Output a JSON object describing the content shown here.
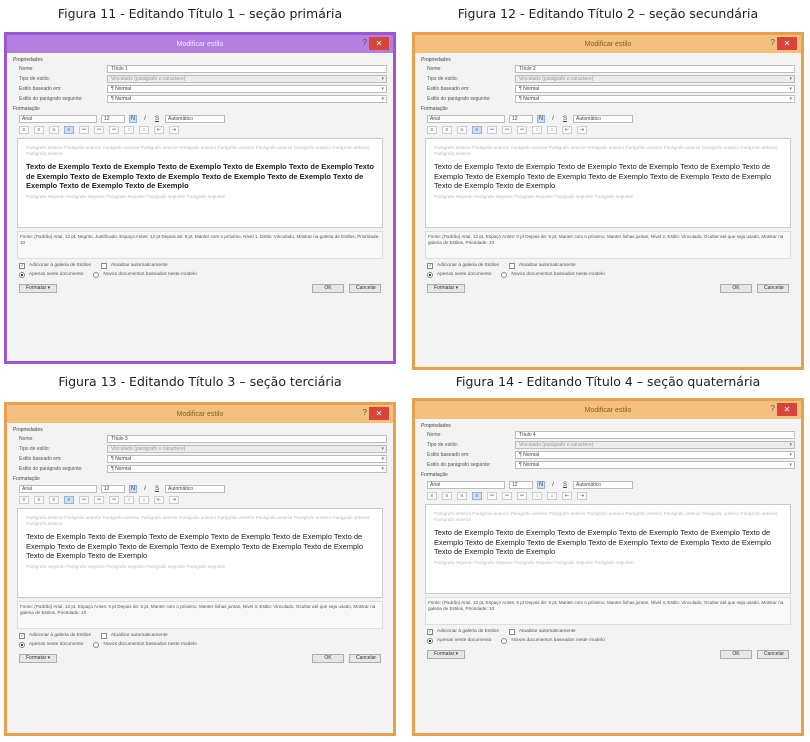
{
  "panels": [
    {
      "caption": "Figura 11 - Editando Título 1 – seção primária",
      "dialog_title": "Modificar estilo",
      "theme": "purple",
      "accent": "#9b57d3",
      "properties_section": "Propriedades",
      "name_label": "Nome:",
      "name_value": "Título 1",
      "type_label": "Tipo de estilo:",
      "type_value": "Vinculado (parágrafo e caractere)",
      "based_label": "Estilo baseado em:",
      "based_value": "¶ Normal",
      "next_label": "Estilo do parágrafo seguinte:",
      "next_value": "¶ Normal",
      "format_section": "Formatação",
      "font": "Arial",
      "size": "12",
      "color": "Automático",
      "ghost_before": "Parágrafo anterior Parágrafo anterior Parágrafo anterior Parágrafo anterior Parágrafo anterior Parágrafo anterior Parágrafo anterior Parágrafo anterior Parágrafo anterior Parágrafo anterior",
      "sample": "Texto de Exemplo Texto de Exemplo Texto de Exemplo Texto de Exemplo Texto de Exemplo Texto de Exemplo Texto de Exemplo Texto de Exemplo Texto de Exemplo Texto de Exemplo Texto de Exemplo Texto de Exemplo Texto de Exemplo",
      "sample_bold": true,
      "ghost_after": "Parágrafo seguinte Parágrafo seguinte Parágrafo seguinte Parágrafo seguinte Parágrafo seguinte",
      "description": "Fonte: (Padrão) Arial, 12 pt, Negrito, Justificado, Espaço Antes: 12 pt Depois de: 6 pt, Manter com o próximo, Nível 1, Estilo: Vinculado, Mostrar na galeria de Estilos, Prioridade: 10",
      "add_gallery": "Adicionar à galeria de Estilos",
      "auto_update": "Atualizar automaticamente",
      "only_doc": "Apenas neste documento",
      "new_docs": "Novos documentos baseados neste modelo",
      "format_btn": "Formatar ▾",
      "ok_btn": "OK",
      "cancel_btn": "Cancelar"
    },
    {
      "caption": "Figura 12 - Editando Título 2 – seção secundária",
      "dialog_title": "Modificar estilo",
      "theme": "orange",
      "accent": "#e8a04d",
      "properties_section": "Propriedades",
      "name_label": "Nome:",
      "name_value": "Título 2",
      "type_label": "Tipo de estilo:",
      "type_value": "Vinculado (parágrafo e caractere)",
      "based_label": "Estilo baseado em:",
      "based_value": "¶ Normal",
      "next_label": "Estilo do parágrafo seguinte:",
      "next_value": "¶ Normal",
      "format_section": "Formatação",
      "font": "Arial",
      "size": "12",
      "color": "Automático",
      "ghost_before": "Parágrafo anterior Parágrafo anterior Parágrafo anterior Parágrafo anterior Parágrafo anterior Parágrafo anterior Parágrafo anterior Parágrafo anterior Parágrafo anterior Parágrafo anterior",
      "sample": "Texto de Exemplo Texto de Exemplo Texto de Exemplo Texto de Exemplo Texto de Exemplo Texto de Exemplo Texto de Exemplo Texto de Exemplo Texto de Exemplo Texto de Exemplo Texto de Exemplo Texto de Exemplo Texto de Exemplo",
      "sample_bold": false,
      "ghost_after": "Parágrafo seguinte Parágrafo seguinte Parágrafo seguinte Parágrafo seguinte Parágrafo seguinte",
      "description": "Fonte: (Padrão) Arial, 12 pt, Espaço Antes: 0 pt Depois de: 6 pt, Manter com o próximo, Manter linhas juntas, Nível 2, Estilo: Vinculado, Ocultar até que seja usado, Mostrar na galeria de Estilos, Prioridade: 10",
      "add_gallery": "Adicionar à galeria de Estilos",
      "auto_update": "Atualizar automaticamente",
      "only_doc": "Apenas neste documento",
      "new_docs": "Novos documentos baseados neste modelo",
      "format_btn": "Formatar ▾",
      "ok_btn": "OK",
      "cancel_btn": "Cancelar"
    },
    {
      "caption": "Figura 13 - Editando Título 3 – seção terciária",
      "dialog_title": "Modificar estilo",
      "theme": "orange",
      "accent": "#e8a04d",
      "properties_section": "Propriedades",
      "name_label": "Nome:",
      "name_value": "Título 3",
      "type_label": "Tipo de estilo:",
      "type_value": "Vinculado (parágrafo e caractere)",
      "based_label": "Estilo baseado em:",
      "based_value": "¶ Normal",
      "next_label": "Estilo do parágrafo seguinte:",
      "next_value": "¶ Normal",
      "format_section": "Formatação",
      "font": "Arial",
      "size": "12",
      "color": "Automático",
      "ghost_before": "Parágrafo anterior Parágrafo anterior Parágrafo anterior Parágrafo anterior Parágrafo anterior Parágrafo anterior Parágrafo anterior Parágrafo anterior Parágrafo anterior Parágrafo anterior",
      "sample": "Texto de Exemplo Texto de Exemplo Texto de Exemplo Texto de Exemplo Texto de Exemplo Texto de Exemplo Texto de Exemplo Texto de Exemplo Texto de Exemplo Texto de Exemplo Texto de Exemplo Texto de Exemplo Texto de Exemplo",
      "sample_bold": false,
      "ghost_after": "Parágrafo seguinte Parágrafo seguinte Parágrafo seguinte Parágrafo seguinte Parágrafo seguinte",
      "description": "Fonte: (Padrão) Arial, 12 pt, Espaço Antes: 6 pt Depois de: 6 pt, Manter com o próximo, Manter linhas juntas, Nível 3, Estilo: Vinculado, Ocultar até que seja usado, Mostrar na galeria de Estilos, Prioridade: 10",
      "add_gallery": "Adicionar à galeria de Estilos",
      "auto_update": "Atualizar automaticamente",
      "only_doc": "Apenas neste documento",
      "new_docs": "Novos documentos baseados neste modelo",
      "format_btn": "Formatar ▾",
      "ok_btn": "OK",
      "cancel_btn": "Cancelar"
    },
    {
      "caption": "Figura 14 - Editando Título 4 – seção quaternária",
      "dialog_title": "Modificar estilo",
      "theme": "orange",
      "accent": "#e8a04d",
      "properties_section": "Propriedades",
      "name_label": "Nome:",
      "name_value": "Título 4",
      "type_label": "Tipo de estilo:",
      "type_value": "Vinculado (parágrafo e caractere)",
      "based_label": "Estilo baseado em:",
      "based_value": "¶ Normal",
      "next_label": "Estilo do parágrafo seguinte:",
      "next_value": "¶ Normal",
      "format_section": "Formatação",
      "font": "Arial",
      "size": "12",
      "color": "Automático",
      "ghost_before": "Parágrafo anterior Parágrafo anterior Parágrafo anterior Parágrafo anterior Parágrafo anterior Parágrafo anterior Parágrafo anterior Parágrafo anterior Parágrafo anterior Parágrafo anterior",
      "sample": "Texto de Exemplo Texto de Exemplo Texto de Exemplo Texto de Exemplo Texto de Exemplo Texto de Exemplo Texto de Exemplo Texto de Exemplo Texto de Exemplo Texto de Exemplo Texto de Exemplo Texto de Exemplo Texto de Exemplo",
      "sample_bold": false,
      "ghost_after": "Parágrafo seguinte Parágrafo seguinte Parágrafo seguinte Parágrafo seguinte Parágrafo seguinte",
      "description": "Fonte: (Padrão) Arial, 12 pt, Espaço Antes: 6 pt Depois de: 6 pt, Manter com o próximo, Manter linhas juntas, Nível 4, Estilo: Vinculado, Ocultar até que seja usado, Mostrar na galeria de Estilos, Prioridade: 10",
      "add_gallery": "Adicionar à galeria de Estilos",
      "auto_update": "Atualizar automaticamente",
      "only_doc": "Apenas neste documento",
      "new_docs": "Novos documentos baseados neste modelo",
      "format_btn": "Formatar ▾",
      "ok_btn": "OK",
      "cancel_btn": "Cancelar"
    }
  ],
  "icons": {
    "close": "close-icon",
    "help": "help-icon",
    "dropdown": "chevron-down-icon",
    "checkbox_checked": "checkbox-checked-icon",
    "radio": "radio-icon"
  }
}
